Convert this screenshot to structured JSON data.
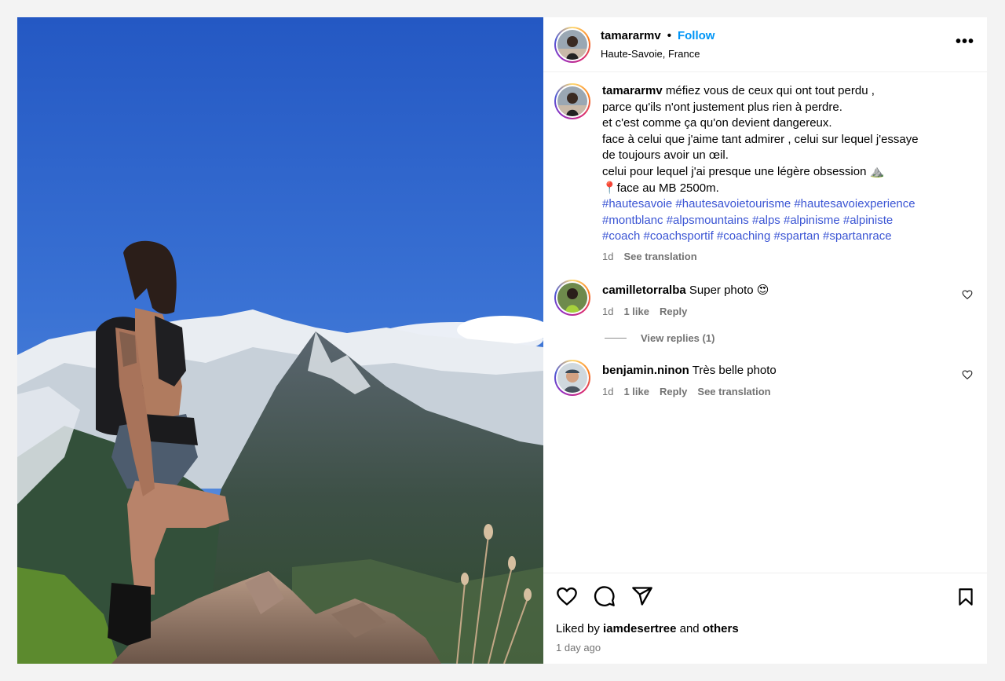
{
  "post": {
    "username": "tamararmv",
    "follow_label": "Follow",
    "separator": "•",
    "location": "Haute-Savoie, France",
    "more_label": "•••"
  },
  "caption": {
    "username": "tamararmv",
    "line1": "méfiez vous de ceux qui ont tout perdu ,",
    "line2": "parce qu'ils n'ont justement plus rien à perdre.",
    "line3": "et c'est comme ça qu'on devient dangereux.",
    "line4": "face à celui que j'aime tant admirer , celui sur lequel j'essaye",
    "line5": "de toujours avoir un œil.",
    "line6": "celui pour lequel j'ai presque une légère obsession ⛰️",
    "line7": "📍face au MB 2500m.",
    "hashtags1": "#hautesavoie #hautesavoietourisme #hautesavoiexperience",
    "hashtags2": "#montblanc #alpsmountains #alps #alpinisme #alpiniste",
    "hashtags3": "#coach #coachsportif #coaching #spartan #spartanrace",
    "time": "1d",
    "see_translation": "See translation"
  },
  "comments": [
    {
      "username": "camilletorralba",
      "text": "Super photo 😍",
      "time": "1d",
      "likes": "1 like",
      "reply": "Reply"
    },
    {
      "username": "benjamin.ninon",
      "text": "Très belle photo",
      "time": "1d",
      "likes": "1 like",
      "reply": "Reply",
      "see_translation": "See translation"
    }
  ],
  "view_replies": "View replies (1)",
  "footer": {
    "liked_prefix": "Liked by",
    "liked_user": "iamdesertree",
    "liked_and": "and",
    "liked_others": "others",
    "ago": "1 day ago"
  },
  "icons": {
    "like": "heart-icon",
    "comment": "comment-bubble-icon",
    "share": "paper-plane-icon",
    "save": "bookmark-icon",
    "more": "more-options-icon"
  },
  "colors": {
    "link_blue": "#0095f6",
    "hashtag_blue": "#3b55d4",
    "muted": "#737373"
  }
}
